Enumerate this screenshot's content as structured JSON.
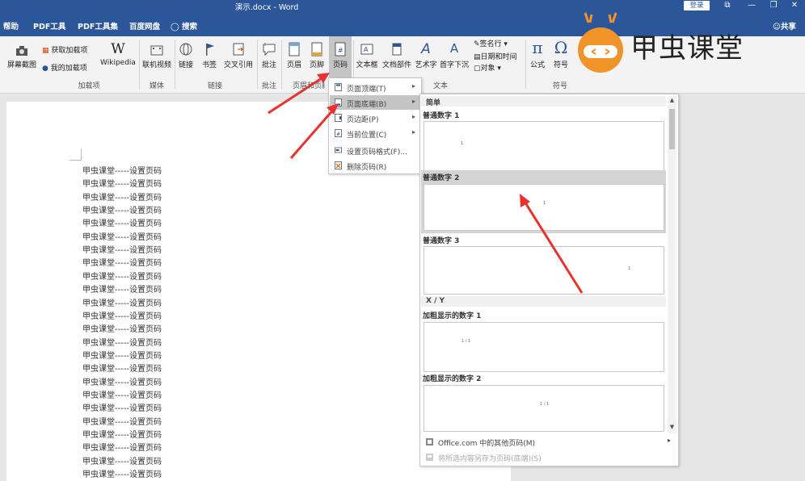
{
  "window": {
    "title": "演示.docx - Word",
    "login_label": "登录",
    "controls": [
      "⧉",
      "—",
      "❐",
      "✕"
    ]
  },
  "menubar": {
    "items": [
      "帮助",
      "PDF工具",
      "PDF工具集",
      "百度网盘",
      "搜索"
    ],
    "share_label": "共享"
  },
  "ribbon": {
    "buttons": {
      "screenshot": "屏幕截图",
      "get_addins": "获取加载项",
      "my_addins": "我的加载项",
      "wikipedia": "Wikipedia",
      "online_video": "联机视频",
      "link": "链接",
      "bookmark": "书签",
      "cross_ref": "交叉引用",
      "comment": "批注",
      "header": "页眉",
      "footer": "页脚",
      "page_number": "页码",
      "textbox": "文本框",
      "quick_parts": "文档部件",
      "wordart": "艺术字",
      "dropcap": "首字下沉",
      "signature": "签名行",
      "datetime": "日期和时间",
      "object": "对象",
      "equation": "公式",
      "symbol": "符号"
    },
    "groups": {
      "addins": "加载项",
      "media": "媒体",
      "links": "链接",
      "comments": "批注",
      "header_footer": "页眉和页脚",
      "text": "文本",
      "symbols": "符号"
    }
  },
  "document": {
    "lines": [
      "甲虫课堂-----设置页码",
      "甲虫课堂-----设置页码",
      "甲虫课堂-----设置页码",
      "甲虫课堂-----设置页码",
      "甲虫课堂-----设置页码",
      "甲虫课堂-----设置页码",
      "甲虫课堂-----设置页码",
      "甲虫课堂-----设置页码",
      "甲虫课堂-----设置页码",
      "甲虫课堂-----设置页码",
      "甲虫课堂-----设置页码",
      "甲虫课堂-----设置页码",
      "甲虫课堂-----设置页码",
      "甲虫课堂-----设置页码",
      "甲虫课堂-----设置页码",
      "甲虫课堂-----设置页码",
      "甲虫课堂-----设置页码",
      "甲虫课堂-----设置页码",
      "甲虫课堂-----设置页码",
      "甲虫课堂-----设置页码",
      "甲虫课堂-----设置页码",
      "甲虫课堂-----设置页码",
      "甲虫课堂-----设置页码",
      "甲虫课堂-----设置页码"
    ]
  },
  "page_number_menu": {
    "items": [
      {
        "label": "页面顶端(T)",
        "submenu": true,
        "highlighted": false,
        "disabled": false
      },
      {
        "label": "页面底端(B)",
        "submenu": true,
        "highlighted": true,
        "disabled": false
      },
      {
        "label": "页边距(P)",
        "submenu": true,
        "highlighted": false,
        "disabled": false
      },
      {
        "label": "当前位置(C)",
        "submenu": true,
        "highlighted": false,
        "disabled": false
      },
      {
        "label": "设置页码格式(F)...",
        "submenu": false,
        "highlighted": false,
        "disabled": false
      },
      {
        "label": "删除页码(R)",
        "submenu": false,
        "highlighted": false,
        "disabled": false
      }
    ]
  },
  "gallery": {
    "section_simple": "简单",
    "section_xy": "X / Y",
    "items": [
      {
        "title": "普通数字 1",
        "sample": "1"
      },
      {
        "title": "普通数字 2",
        "sample": "1"
      },
      {
        "title": "普通数字 3",
        "sample": "1"
      },
      {
        "title": "加粗显示的数字 1",
        "sample": "1 / 1"
      },
      {
        "title": "加粗显示的数字 2",
        "sample": "1 / 1"
      }
    ],
    "more_label": "Office.com 中的其他页码(M)",
    "save_label": "将所选内容另存为页码(底端)(S)"
  },
  "watermark": {
    "brand_text": "甲虫课堂"
  },
  "colors": {
    "titlebar": "#2b579a",
    "ribbon": "#f3f3f3",
    "arrow": "#e8322d",
    "highlight": "#c5c5c5"
  }
}
